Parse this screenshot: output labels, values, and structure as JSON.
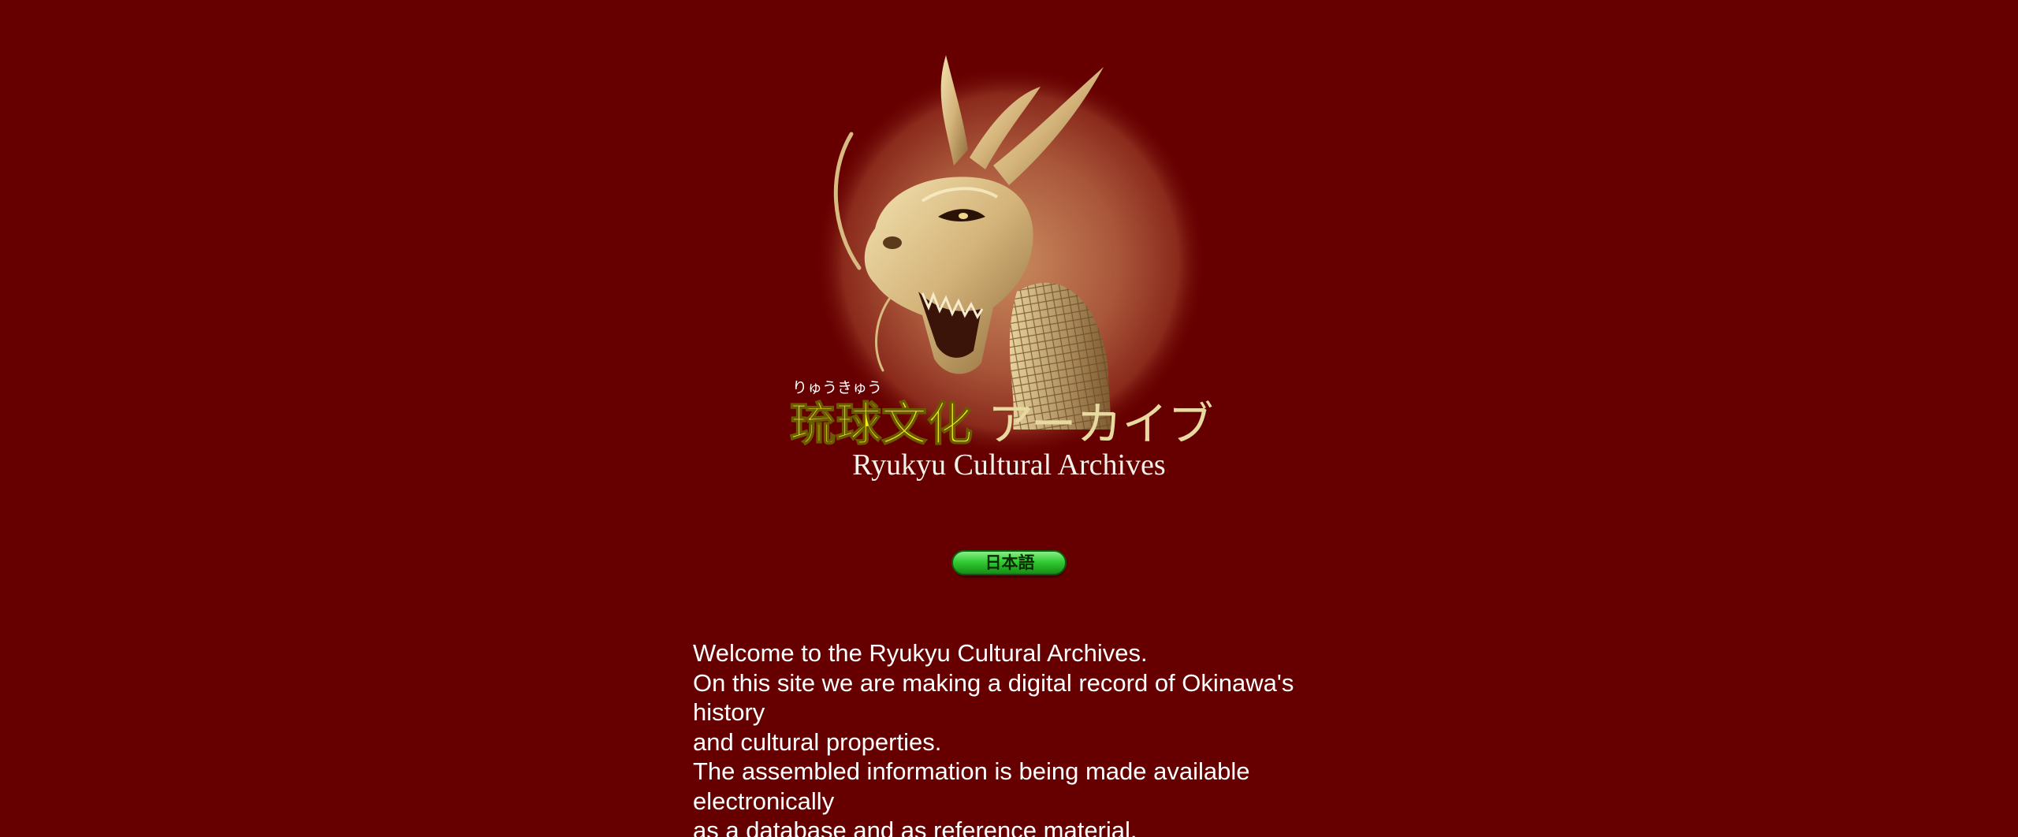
{
  "logo": {
    "ruby": "りゅうきゅう",
    "title_kanji": "琉球文化",
    "title_kana": "アーカイブ",
    "title_en": "Ryukyu Cultural Archives",
    "icon": "dragon-emblem"
  },
  "language_button": {
    "label": "日本語",
    "color": "#33cc33"
  },
  "intro": {
    "lines": [
      "Welcome to the Ryukyu Cultural Archives.",
      "On this site we are making a digital record of Okinawa's history",
      "and cultural properties.",
      "The assembled information is being made available electronically",
      "as a database and as reference material."
    ]
  },
  "colors": {
    "background": "#660000",
    "title_yellow": "#f2ea18",
    "text": "#ffffff"
  }
}
